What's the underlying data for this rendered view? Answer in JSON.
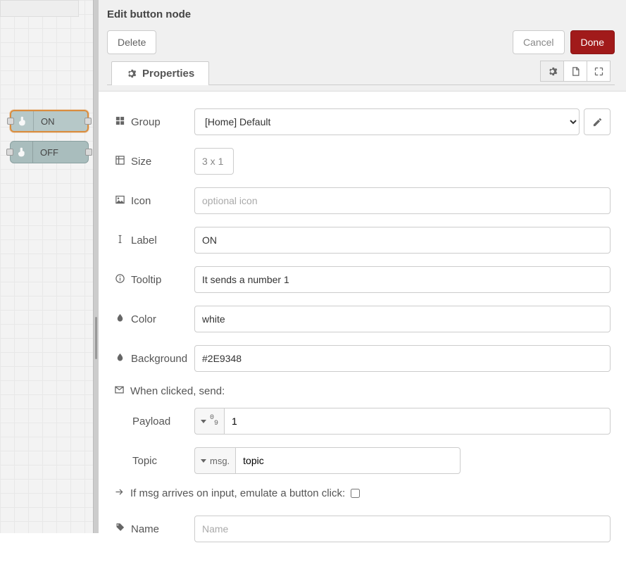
{
  "canvas": {
    "nodes": [
      {
        "label": "ON"
      },
      {
        "label": "OFF"
      }
    ]
  },
  "panel": {
    "title": "Edit button node",
    "buttons": {
      "delete": "Delete",
      "cancel": "Cancel",
      "done": "Done"
    },
    "tab": {
      "properties": "Properties"
    }
  },
  "form": {
    "labels": {
      "group": "Group",
      "size": "Size",
      "icon": "Icon",
      "label": "Label",
      "tooltip": "Tooltip",
      "color": "Color",
      "background": "Background",
      "when_clicked": "When clicked, send:",
      "payload": "Payload",
      "topic": "Topic",
      "emulate": "If msg arrives on input, emulate a button click:",
      "name": "Name"
    },
    "values": {
      "group": "[Home] Default",
      "size": "3 x 1",
      "icon_placeholder": "optional icon",
      "label": "ON",
      "tooltip": "It sends a number 1",
      "color": "white",
      "background": "#2E9348",
      "payload_type": "num",
      "payload": "1",
      "topic_type": "msg.",
      "topic": "topic",
      "emulate_checked": false,
      "name_placeholder": "Name"
    }
  }
}
